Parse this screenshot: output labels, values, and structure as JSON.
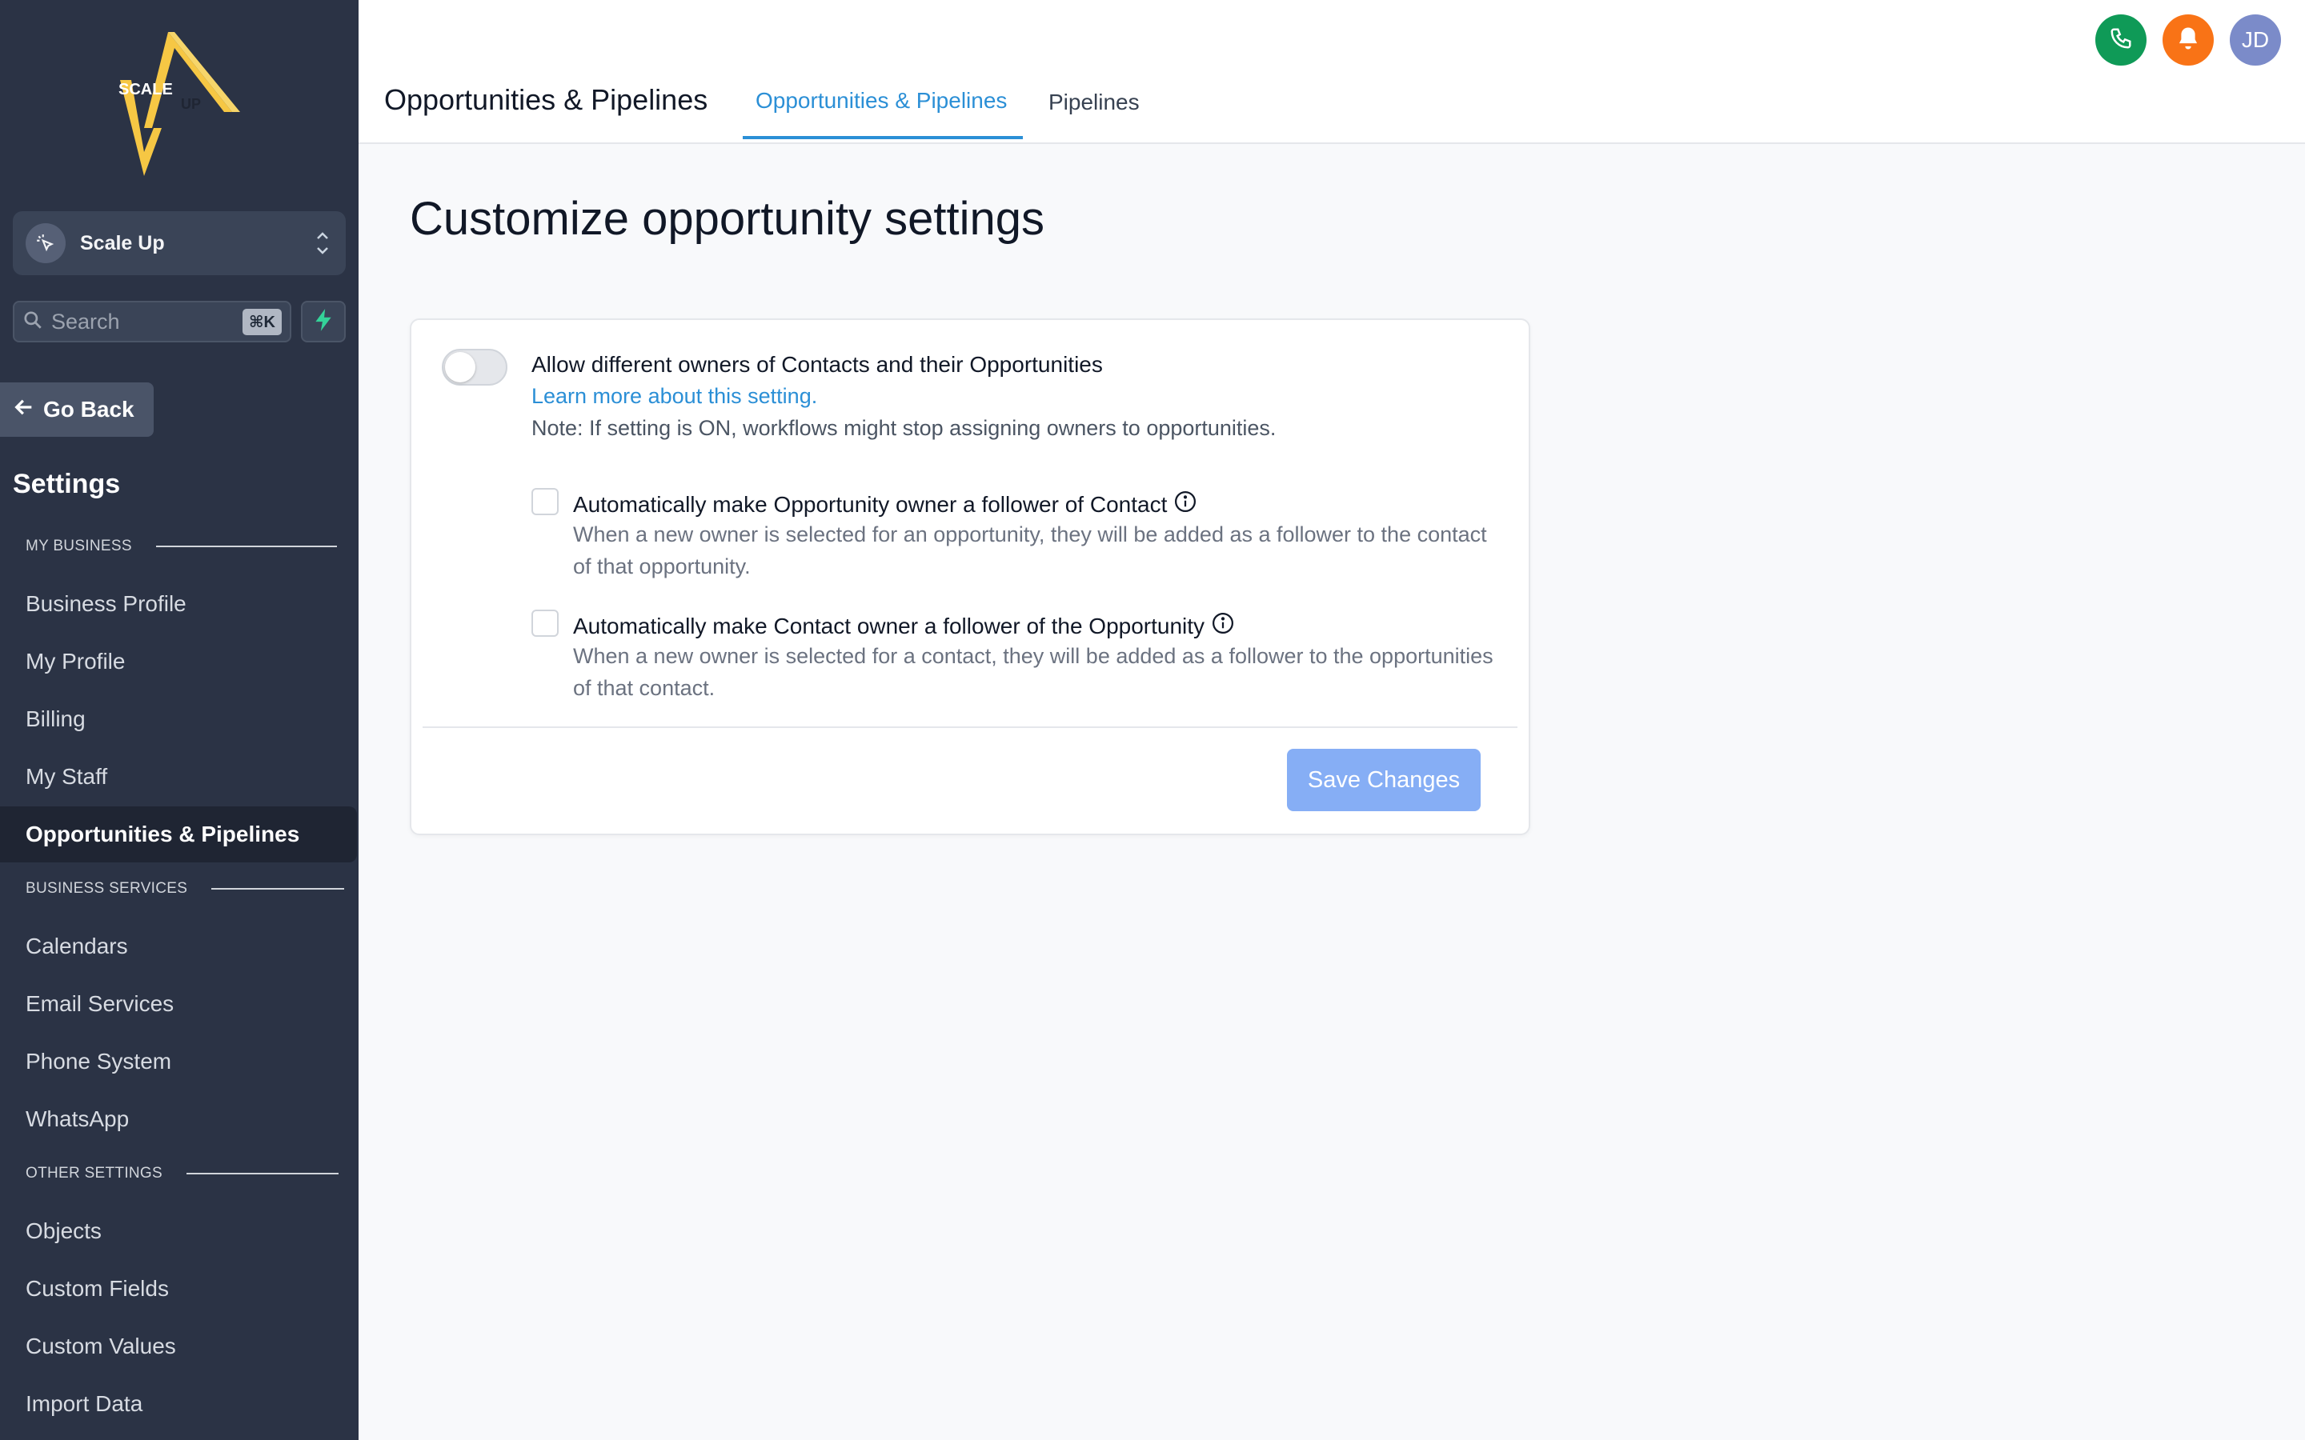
{
  "sidebar": {
    "logo_text": {
      "line1": "SCALE",
      "line2": "UP"
    },
    "account_name": "Scale Up",
    "search_placeholder": "Search",
    "search_shortcut": "⌘K",
    "go_back": "Go Back",
    "settings_title": "Settings",
    "sections": {
      "my_business": "MY BUSINESS",
      "business_services": "BUSINESS SERVICES",
      "other_settings": "OTHER SETTINGS"
    },
    "items": [
      "Business Profile",
      "My Profile",
      "Billing",
      "My Staff",
      "Opportunities & Pipelines",
      "Calendars",
      "Email Services",
      "Phone System",
      "WhatsApp",
      "Objects",
      "Custom Fields",
      "Custom Values",
      "Import Data"
    ],
    "active_item": "Opportunities & Pipelines"
  },
  "header": {
    "title": "Opportunities & Pipelines",
    "tabs": [
      "Opportunities & Pipelines",
      "Pipelines"
    ],
    "active_tab": "Opportunities & Pipelines",
    "avatar_initials": "JD",
    "icons": [
      "phone-icon",
      "bell-icon"
    ],
    "colors": {
      "phone": "#0f9a57",
      "bell": "#f97316",
      "avatar": "#7b8bc9",
      "accent": "#2b8fd6"
    }
  },
  "main": {
    "title": "Customize opportunity settings",
    "setting": {
      "title": "Allow different owners of Contacts and their Opportunities",
      "link": "Learn more about this setting.",
      "note": "Note: If setting is ON, workflows might stop assigning owners to opportunities.",
      "toggle_on": false
    },
    "options": [
      {
        "title": "Automatically make Opportunity owner a follower of Contact",
        "description": "When a new owner is selected for an opportunity, they will be added as a follower to the contact of that opportunity.",
        "checked": false
      },
      {
        "title": "Automatically make Contact owner a follower of the Opportunity",
        "description": "When a new owner is selected for a contact, they will be added as a follower to the opportunities of that contact.",
        "checked": false
      }
    ],
    "save_label": "Save Changes"
  }
}
